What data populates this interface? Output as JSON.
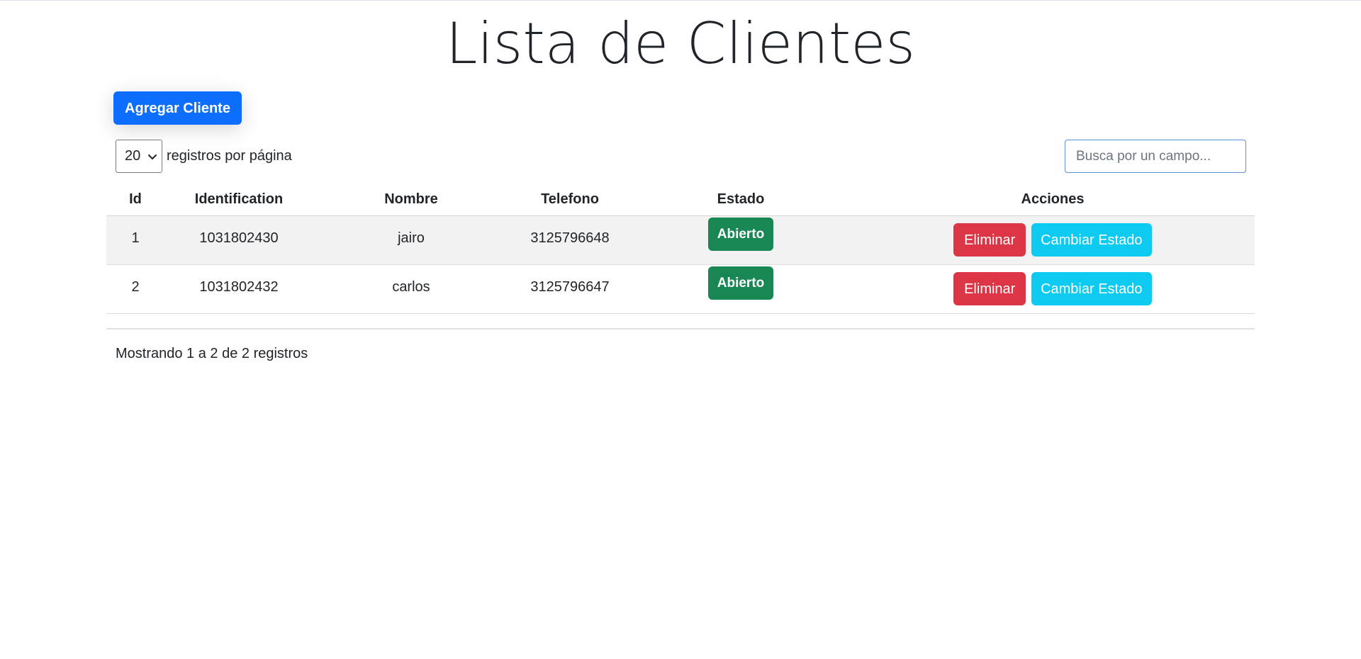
{
  "page": {
    "title": "Lista de Clientes"
  },
  "toolbar": {
    "add_label": "Agregar Cliente"
  },
  "length_menu": {
    "selected": "20",
    "label": "registros por página"
  },
  "search": {
    "placeholder": "Busca por un campo..."
  },
  "table": {
    "headers": {
      "id": "Id",
      "identification": "Identification",
      "nombre": "Nombre",
      "telefono": "Telefono",
      "estado": "Estado",
      "acciones": "Acciones"
    },
    "rows": [
      {
        "id": "1",
        "identification": "1031802430",
        "nombre": "jairo",
        "telefono": "3125796648",
        "estado": "Abierto",
        "delete_label": "Eliminar",
        "change_label": "Cambiar Estado"
      },
      {
        "id": "2",
        "identification": "1031802432",
        "nombre": "carlos",
        "telefono": "3125796647",
        "estado": "Abierto",
        "delete_label": "Eliminar",
        "change_label": "Cambiar Estado"
      }
    ]
  },
  "info": "Mostrando 1 a 2 de 2 registros",
  "colors": {
    "primary": "#0d6efd",
    "success": "#198754",
    "danger": "#dc3545",
    "info": "#0dcaf0"
  },
  "icons": {
    "select_arrow": "chevron-down-icon"
  }
}
